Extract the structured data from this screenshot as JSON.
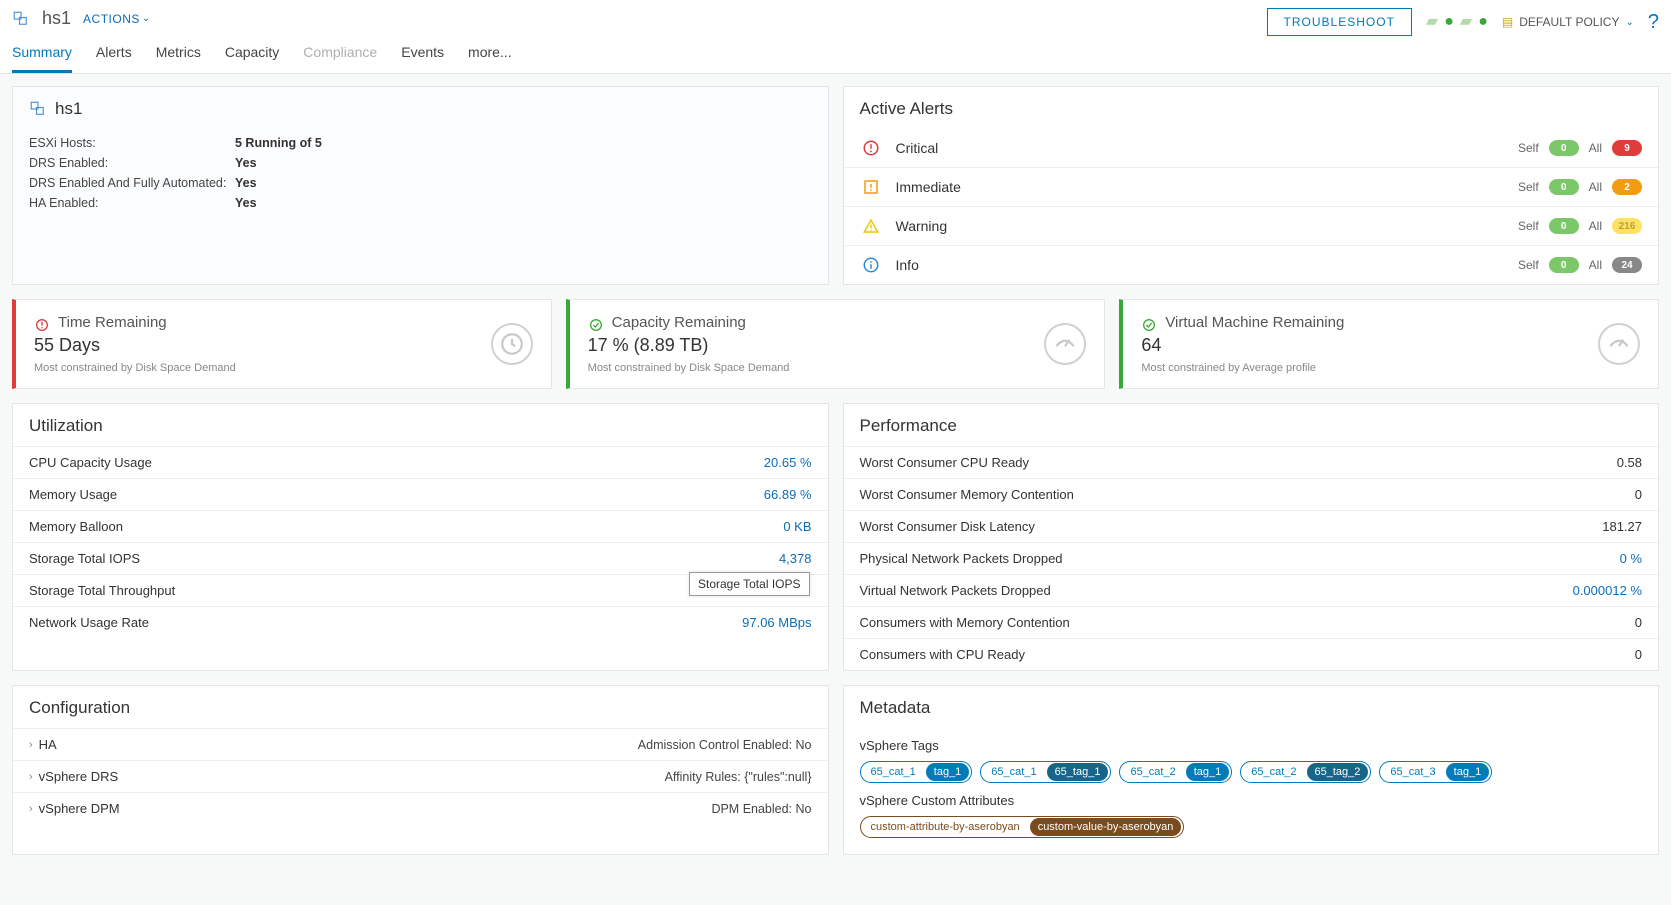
{
  "header": {
    "cluster_name": "hs1",
    "actions_label": "ACTIONS",
    "troubleshoot_label": "TROUBLESHOOT",
    "policy_label": "DEFAULT POLICY"
  },
  "tabs": [
    "Summary",
    "Alerts",
    "Metrics",
    "Capacity",
    "Compliance",
    "Events",
    "more..."
  ],
  "tabs_active": "Summary",
  "tabs_disabled": [
    "Compliance"
  ],
  "summary": {
    "name": "hs1",
    "props": [
      {
        "k": "ESXi Hosts:",
        "v": "5 Running of 5"
      },
      {
        "k": "DRS Enabled:",
        "v": "Yes"
      },
      {
        "k": "DRS Enabled And Fully Automated:",
        "v": "Yes"
      },
      {
        "k": "HA Enabled:",
        "v": "Yes"
      }
    ]
  },
  "alerts": {
    "title": "Active Alerts",
    "rows": [
      {
        "name": "Critical",
        "color": "#e03c3c",
        "self": "0",
        "all": "9",
        "all_pill": "red"
      },
      {
        "name": "Immediate",
        "color": "#f39c11",
        "self": "0",
        "all": "2",
        "all_pill": "orange"
      },
      {
        "name": "Warning",
        "color": "#f1c40f",
        "self": "0",
        "all": "216",
        "all_pill": "yellow"
      },
      {
        "name": "Info",
        "color": "#2f8bd8",
        "self": "0",
        "all": "24",
        "all_pill": "grey"
      }
    ]
  },
  "capacity_cards": [
    {
      "title": "Time Remaining",
      "value": "55 Days",
      "note": "Most constrained by Disk Space Demand",
      "style": "red",
      "icon": "clock"
    },
    {
      "title": "Capacity Remaining",
      "value": "17 % (8.89 TB)",
      "note": "Most constrained by Disk Space Demand",
      "style": "green",
      "icon": "gauge"
    },
    {
      "title": "Virtual Machine Remaining",
      "value": "64",
      "note": "Most constrained by Average profile",
      "style": "green",
      "icon": "gauge"
    }
  ],
  "utilization": {
    "title": "Utilization",
    "rows": [
      {
        "label": "CPU Capacity Usage",
        "value": "20.65 %"
      },
      {
        "label": "Memory Usage",
        "value": "66.89 %"
      },
      {
        "label": "Memory Balloon",
        "value": "0 KB"
      },
      {
        "label": "Storage Total IOPS",
        "value": "4,378"
      },
      {
        "label": "Storage Total Throughput",
        "value": ""
      },
      {
        "label": "Network Usage Rate",
        "value": "97.06 MBps"
      }
    ],
    "tooltip": "Storage Total IOPS"
  },
  "performance": {
    "title": "Performance",
    "rows": [
      {
        "label": "Worst Consumer CPU Ready",
        "value": "0.58",
        "plain": true
      },
      {
        "label": "Worst Consumer Memory Contention",
        "value": "0",
        "plain": true
      },
      {
        "label": "Worst Consumer Disk Latency",
        "value": "181.27",
        "plain": true
      },
      {
        "label": "Physical Network Packets Dropped",
        "value": "0 %",
        "plain": false
      },
      {
        "label": "Virtual Network Packets Dropped",
        "value": "0.000012 %",
        "plain": false
      },
      {
        "label": "Consumers with Memory Contention",
        "value": "0",
        "plain": true
      },
      {
        "label": "Consumers with CPU Ready",
        "value": "0",
        "plain": true
      }
    ]
  },
  "configuration": {
    "title": "Configuration",
    "rows": [
      {
        "name": "HA",
        "right": "Admission Control Enabled: No"
      },
      {
        "name": "vSphere DRS",
        "right": "Affinity Rules: {\"rules\":null}"
      },
      {
        "name": "vSphere DPM",
        "right": "DPM Enabled: No"
      }
    ]
  },
  "metadata": {
    "title": "Metadata",
    "tags_label": "vSphere Tags",
    "tags": [
      {
        "label": "65_cat_1",
        "value": "tag_1",
        "variant": ""
      },
      {
        "label": "65_cat_1",
        "value": "65_tag_1",
        "variant": "dark"
      },
      {
        "label": "65_cat_2",
        "value": "tag_1",
        "variant": ""
      },
      {
        "label": "65_cat_2",
        "value": "65_tag_2",
        "variant": "dark"
      },
      {
        "label": "65_cat_3",
        "value": "tag_1",
        "variant": ""
      }
    ],
    "attrs_label": "vSphere Custom Attributes",
    "attrs": [
      {
        "label": "custom-attribute-by-aserobyan",
        "value": "custom-value-by-aserobyan",
        "variant": "brown"
      }
    ]
  }
}
